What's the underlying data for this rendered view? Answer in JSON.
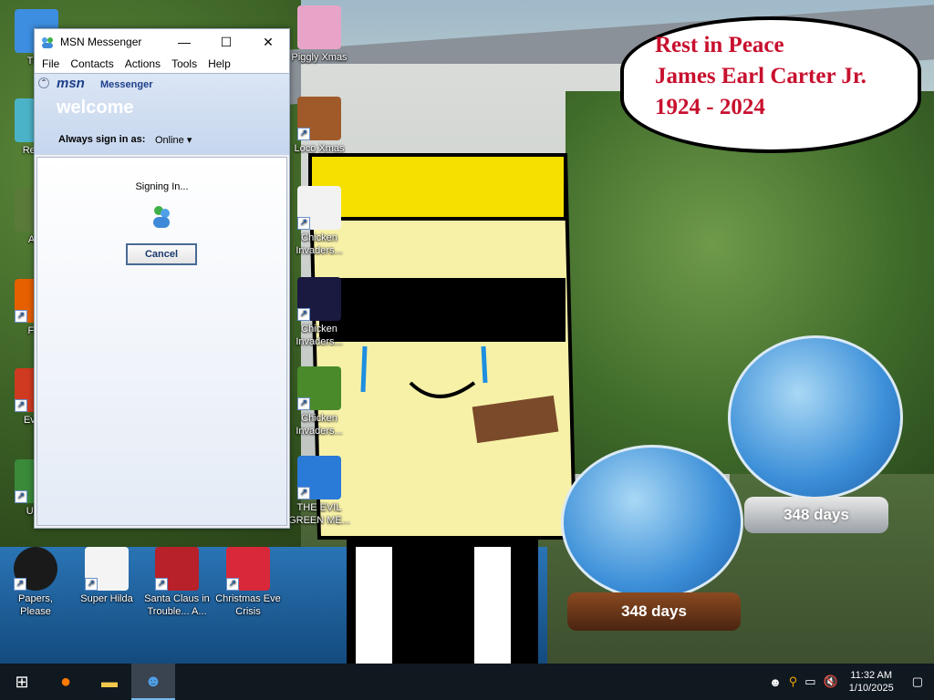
{
  "window": {
    "title": "MSN Messenger",
    "menu": [
      "File",
      "Contacts",
      "Actions",
      "Tools",
      "Help"
    ],
    "brand": "msn",
    "brand_suffix": "Messenger",
    "welcome": "welcome",
    "sign_in_label": "Always sign in as:",
    "sign_in_status": "Online",
    "signing_in": "Signing In...",
    "cancel_label": "Cancel"
  },
  "bubble": {
    "line1": "Rest in Peace",
    "line2": "James Earl Carter Jr.",
    "line3": "1924 - 2024"
  },
  "globes": {
    "left_days": "348 days",
    "right_days": "348 days"
  },
  "desktop_icons": [
    {
      "label": "This"
    },
    {
      "label": "Recyc"
    },
    {
      "label": "Acti"
    },
    {
      "label": "Fire"
    },
    {
      "label": "Every"
    },
    {
      "label": "Undi"
    },
    {
      "label": "Piggly Xmas"
    },
    {
      "label": "Loco Xmas"
    },
    {
      "label": "Chicken Invaders..."
    },
    {
      "label": "Chicken Invaders..."
    },
    {
      "label": "Chicken Invaders..."
    },
    {
      "label": "THE EVIL GREEN ME..."
    },
    {
      "label": "Papers, Please"
    },
    {
      "label": "Super Hilda"
    },
    {
      "label": "Santa Claus in Trouble... A..."
    },
    {
      "label": "Christmas Eve Crisis"
    }
  ],
  "taskbar": {
    "time": "11:32 AM",
    "date": "1/10/2025"
  },
  "colors": {
    "bubble_text": "#c8102e",
    "taskbar": "#101820"
  }
}
